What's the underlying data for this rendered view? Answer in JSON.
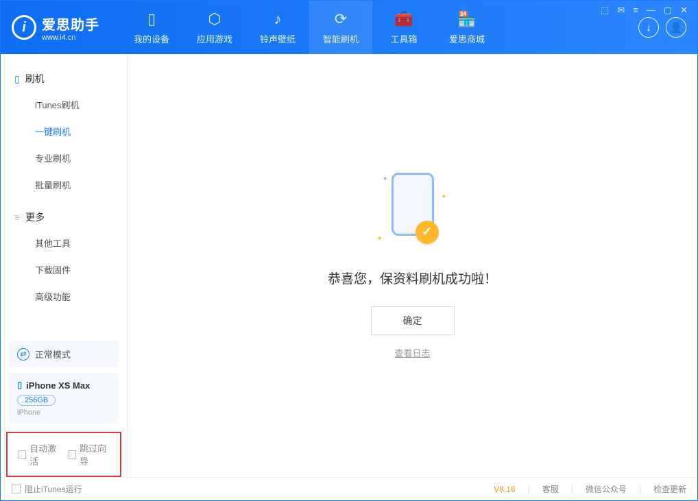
{
  "app": {
    "name": "爱思助手",
    "url": "www.i4.cn"
  },
  "tabs": [
    {
      "label": "我的设备",
      "icon": "▯"
    },
    {
      "label": "应用游戏",
      "icon": "⬡"
    },
    {
      "label": "铃声壁纸",
      "icon": "♪"
    },
    {
      "label": "智能刷机",
      "icon": "⟳",
      "active": true
    },
    {
      "label": "工具箱",
      "icon": "🧰"
    },
    {
      "label": "爱思商城",
      "icon": "🏪"
    }
  ],
  "sidebar": {
    "group1": {
      "title": "刷机",
      "items": [
        {
          "label": "iTunes刷机"
        },
        {
          "label": "一键刷机",
          "active": true
        },
        {
          "label": "专业刷机"
        },
        {
          "label": "批量刷机"
        }
      ]
    },
    "group2": {
      "title": "更多",
      "items": [
        {
          "label": "其他工具"
        },
        {
          "label": "下载固件"
        },
        {
          "label": "高级功能"
        }
      ]
    },
    "mode": "正常模式",
    "device": {
      "name": "iPhone XS Max",
      "storage": "256GB",
      "type": "iPhone"
    },
    "checks": {
      "auto_activate": "自动激活",
      "skip_guide": "跳过向导"
    }
  },
  "main": {
    "message": "恭喜您，保资料刷机成功啦！",
    "ok": "确定",
    "log_link": "查看日志"
  },
  "footer": {
    "block_itunes": "阻止iTunes运行",
    "version": "V8.16",
    "links": [
      "客服",
      "微信公众号",
      "检查更新"
    ]
  }
}
